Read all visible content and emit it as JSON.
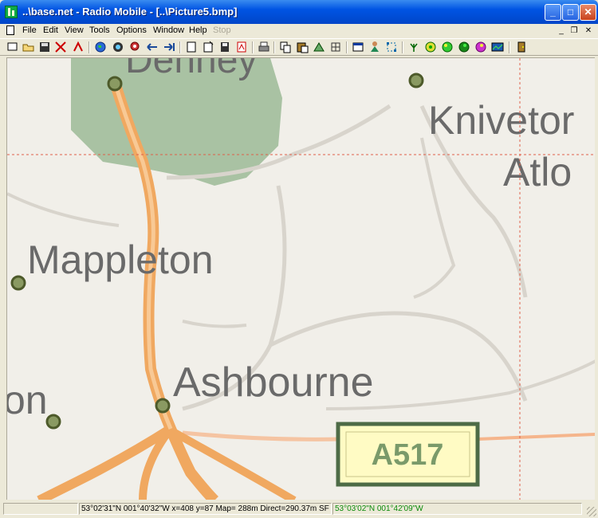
{
  "window": {
    "title": "..\\base.net - Radio Mobile - [..\\Picture5.bmp]",
    "min_glyph": "_",
    "max_glyph": "□",
    "close_glyph": "✕"
  },
  "menu": {
    "items": [
      "File",
      "Edit",
      "View",
      "Tools",
      "Options",
      "Window",
      "Help",
      "Stop"
    ],
    "mdi_min": "_",
    "mdi_restore": "❐",
    "mdi_close": "✕"
  },
  "toolbar": {
    "icons": [
      "new-icon",
      "open-icon",
      "save-icon",
      "network-icon",
      "link-icon",
      "world-icon",
      "disk-icon",
      "search-map-icon",
      "arrow-left-icon",
      "arrow-right-icon",
      "map-doc-icon",
      "map-new-icon",
      "map-save-icon",
      "pdf-icon",
      "print-icon",
      "copy-icon",
      "paste-icon",
      "merge-icon",
      "grid-icon",
      "panel-icon",
      "person-icon",
      "select-icon",
      "antenna-icon",
      "coverage1-icon",
      "coverage2-icon",
      "coverage3-icon",
      "coverage4-icon",
      "profile-icon",
      "exit-icon"
    ]
  },
  "map": {
    "labels": {
      "town1": "Mappleton",
      "town2": "Ashbourne",
      "town3": "Knivetor",
      "town4": "Atlo",
      "town5": "Denney",
      "town6": "on",
      "road": "A517"
    },
    "colors": {
      "background": "#f1efe9",
      "green": "#a9c2a3",
      "road": "#f0a860",
      "shield_fill": "#fffbc4",
      "shield_border": "#4d6b46",
      "crosshair": "#e0604a"
    }
  },
  "status": {
    "cell1": "53°02'31\"N  001°40'32\"W  x=408 y=87 Map= 288m Direct=290.37m SF",
    "cell2": "53°03'02\"N  001°42'09\"W"
  }
}
